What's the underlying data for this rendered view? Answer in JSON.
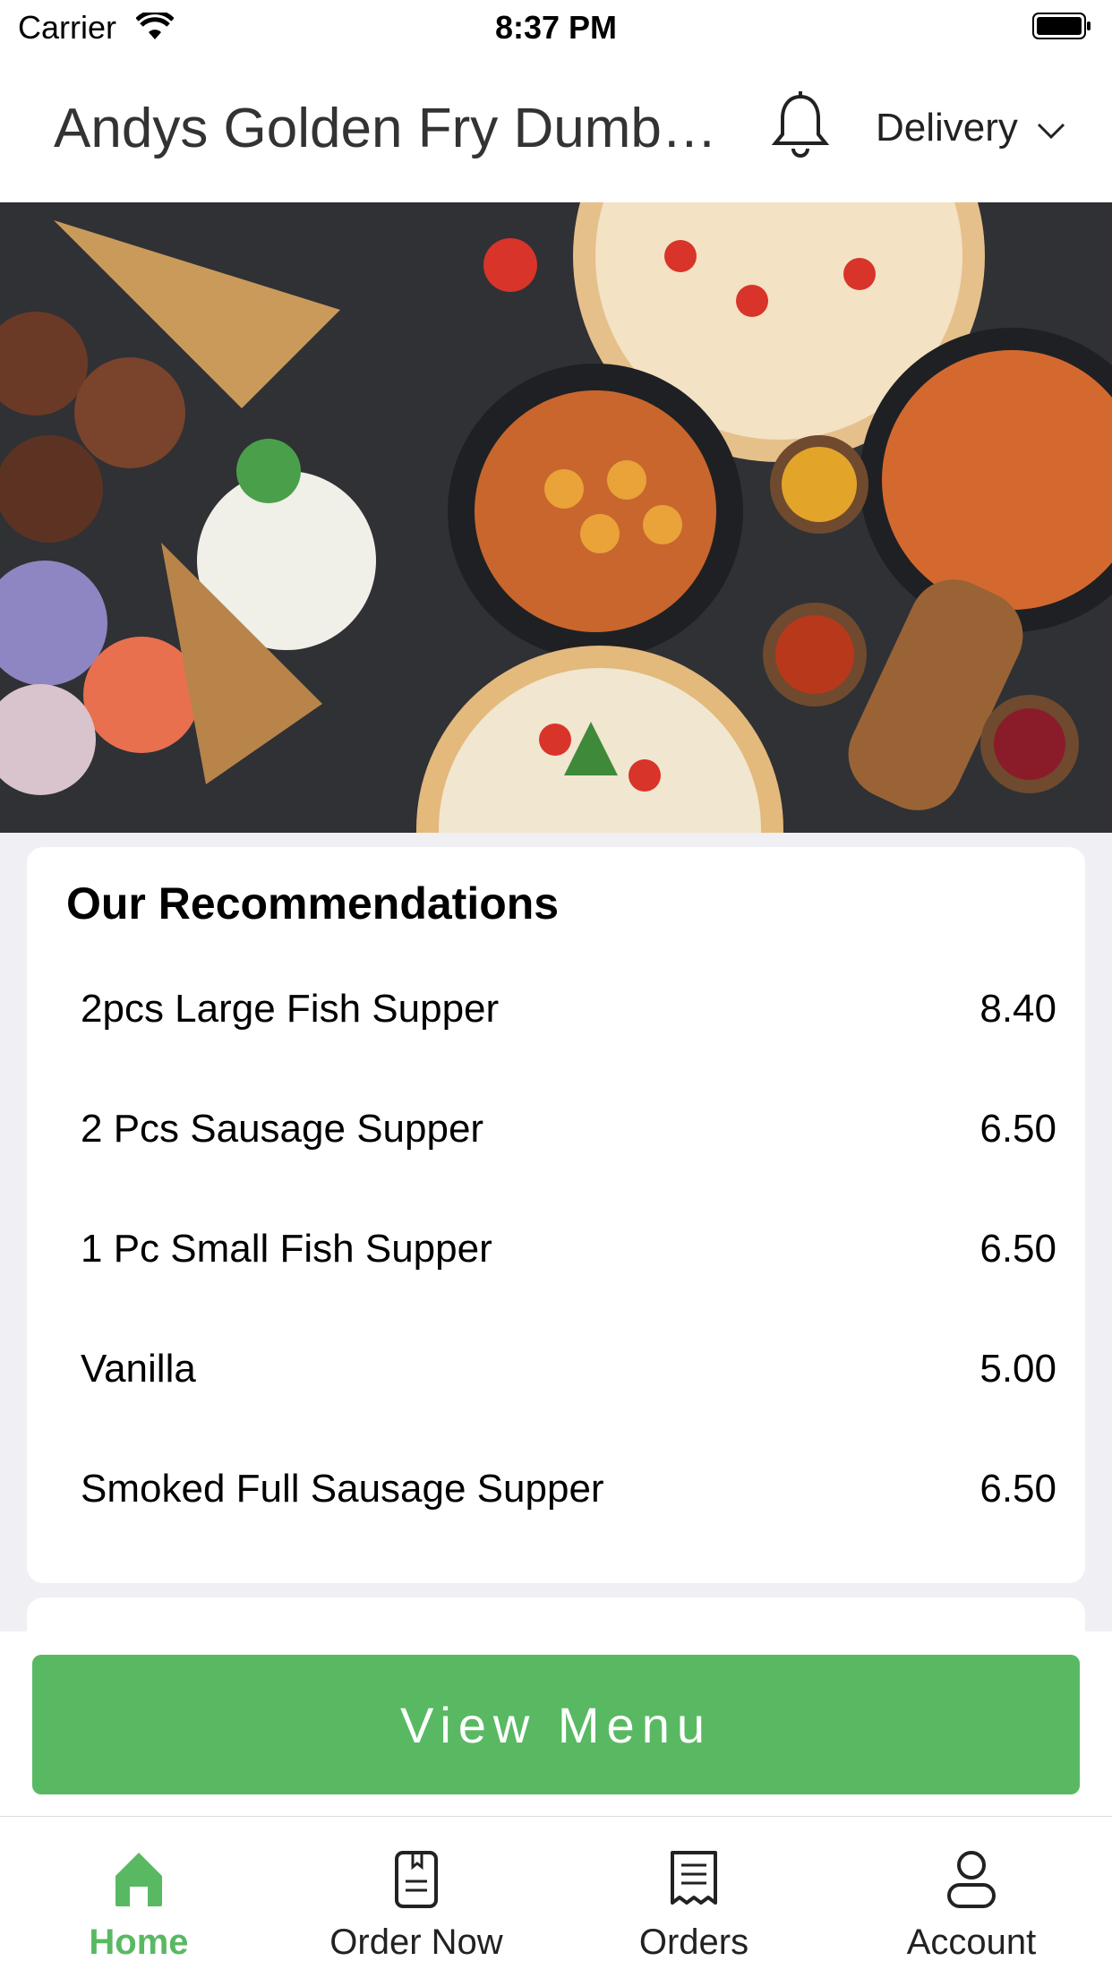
{
  "status_bar": {
    "carrier": "Carrier",
    "time": "8:37 PM"
  },
  "header": {
    "title": "Andys Golden Fry Dumba...",
    "order_type": "Delivery",
    "bell_icon": "bell-icon"
  },
  "recommendations": {
    "title": "Our Recommendations",
    "items": [
      {
        "name": "2pcs Large Fish Supper",
        "price": "8.40"
      },
      {
        "name": "2 Pcs Sausage Supper",
        "price": "6.50"
      },
      {
        "name": "1 Pc Small Fish Supper",
        "price": "6.50"
      },
      {
        "name": "Vanilla",
        "price": "5.00"
      },
      {
        "name": "Smoked Full Sausage Supper",
        "price": "6.50"
      }
    ]
  },
  "view_menu_label": "View Menu",
  "tabs": [
    {
      "label": "Home",
      "icon": "home-icon",
      "active": true
    },
    {
      "label": "Order Now",
      "icon": "menu-book-icon",
      "active": false
    },
    {
      "label": "Orders",
      "icon": "receipt-icon",
      "active": false
    },
    {
      "label": "Account",
      "icon": "user-icon",
      "active": false
    }
  ],
  "colors": {
    "accent": "#59b962",
    "hero_background": "#2f3135"
  }
}
